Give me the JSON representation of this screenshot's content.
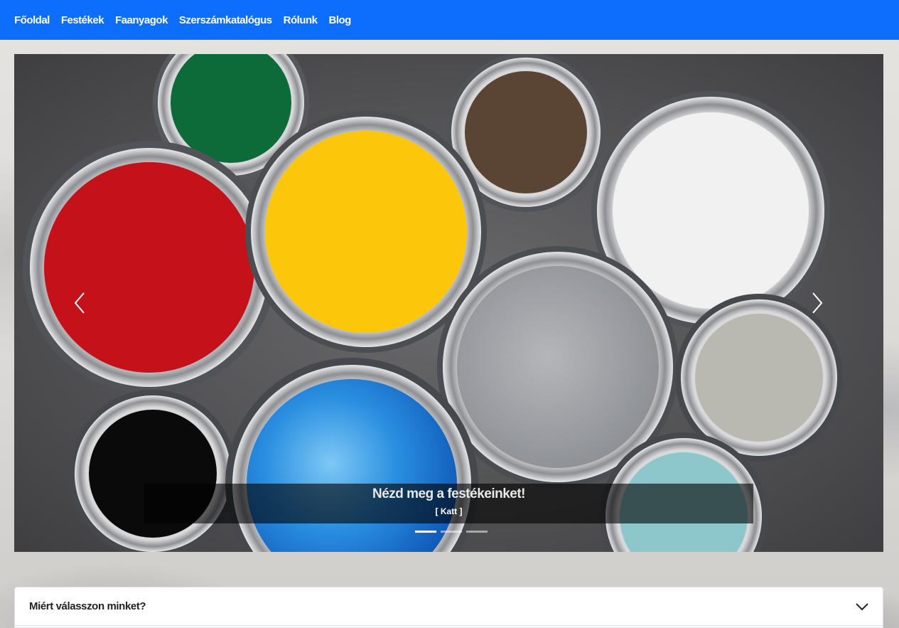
{
  "nav": {
    "items": [
      "Főoldal",
      "Festékek",
      "Faanyagok",
      "Szerszámkatalógus",
      "Rólunk",
      "Blog"
    ]
  },
  "carousel": {
    "caption_title": "Nézd meg a festékeinket!",
    "caption_link": "[ Katt ]",
    "slides_count": 3,
    "active_slide": 1,
    "prev_icon": "chevron-left-icon",
    "next_icon": "chevron-right-icon"
  },
  "accordion": {
    "title": "Miért válasszon minket?",
    "toggle_icon": "chevron-down-icon"
  },
  "colors": {
    "navbar": "#0d6efd",
    "caption_bg": "rgba(0,0,0,0.6)"
  }
}
